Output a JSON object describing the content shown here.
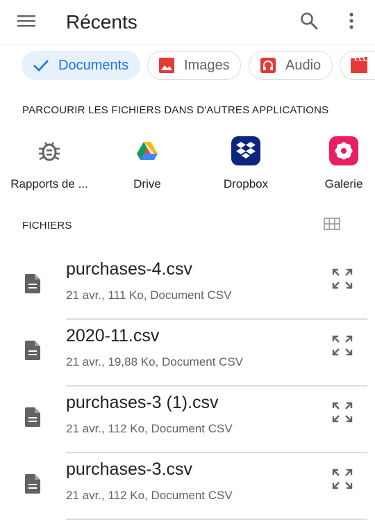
{
  "header": {
    "title": "Récents",
    "menu_icon": "menu-icon",
    "search_icon": "search-icon",
    "more_icon": "more-vert-icon"
  },
  "chips": [
    {
      "label": "Documents",
      "icon": "check-icon",
      "selected": true
    },
    {
      "label": "Images",
      "icon": "image-icon",
      "color": "#e53935"
    },
    {
      "label": "Audio",
      "icon": "headphones-icon",
      "color": "#e53935"
    },
    {
      "label": "",
      "icon": "movie-icon",
      "color": "#e53935"
    }
  ],
  "apps_section": {
    "title": "PARCOURIR LES FICHIERS DANS D'AUTRES APPLICATIONS"
  },
  "apps": [
    {
      "label": "Rapports de ...",
      "icon": "bug-icon"
    },
    {
      "label": "Drive",
      "icon": "google-drive-icon"
    },
    {
      "label": "Dropbox",
      "icon": "dropbox-icon",
      "color": "#0d2481"
    },
    {
      "label": "Galerie",
      "icon": "gallery-flower-icon",
      "color": "#e91e63"
    }
  ],
  "files_section": {
    "title": "FICHIERS",
    "grid_icon": "grid-view-icon"
  },
  "files": [
    {
      "name": "purchases-4.csv",
      "meta": "21 avr., 111 Ko, Document CSV"
    },
    {
      "name": "2020-11.csv",
      "meta": "21 avr., 19,88 Ko, Document CSV"
    },
    {
      "name": "purchases-3 (1).csv",
      "meta": "21 avr., 112 Ko, Document CSV"
    },
    {
      "name": "purchases-3.csv",
      "meta": "21 avr., 112 Ko, Document CSV"
    }
  ]
}
